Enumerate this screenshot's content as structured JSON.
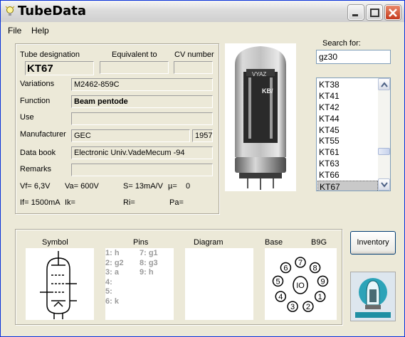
{
  "window": {
    "title": "TubeData"
  },
  "menu": {
    "file": "File",
    "help": "Help"
  },
  "header_labels": {
    "designation": "Tube designation",
    "equivalent": "Equivalent to",
    "cv": "CV number"
  },
  "tube": {
    "designation": "KT67",
    "equivalent": "",
    "cv": "",
    "variations": "M2462-859C",
    "function": "Beam pentode",
    "use": "",
    "manufacturer": "GEC",
    "year": "1957",
    "databook": "Electronic Univ.VadeMecum -94",
    "remarks": ""
  },
  "field_labels": {
    "variations": "Variations",
    "function": "Function",
    "use": "Use",
    "manufacturer": "Manufacturer",
    "databook": "Data book",
    "remarks": "Remarks"
  },
  "params": {
    "vf": "Vf= 6,3V",
    "va": "Va= 600V",
    "s": "S= 13mA/V",
    "mu": "µ=",
    "mu_value": "0",
    "if": "If= 1500mA",
    "ik": "Ik=",
    "ri": "Ri=",
    "pa": "Pa="
  },
  "search": {
    "label": "Search for:",
    "value": "gz30"
  },
  "tube_list": [
    "KT38",
    "KT41",
    "KT42",
    "KT44",
    "KT45",
    "KT55",
    "KT61",
    "KT63",
    "KT66",
    "KT67"
  ],
  "selected_tube": "KT67",
  "bottom_labels": {
    "symbol": "Symbol",
    "pins": "Pins",
    "diagram": "Diagram",
    "base": "Base",
    "base_type": "B9G"
  },
  "pins_left": [
    "1: h",
    "2: g2",
    "3: a",
    "4:",
    "5:",
    "6: k"
  ],
  "pins_right": [
    "7: g1",
    "8: g3",
    "9: h"
  ],
  "base_pin_numbers": [
    "1",
    "2",
    "3",
    "4",
    "5",
    "6",
    "7",
    "8",
    "9"
  ],
  "base_center_label": "IO",
  "buttons": {
    "inventory": "Inventory"
  },
  "colors": {
    "title_bar": "#DCDCDC",
    "selection": "#C9C9C9",
    "pin_text": "#9A9A9A",
    "window_bg": "#ECE9D8"
  },
  "icons": [
    "lightbulb-icon",
    "minimize-icon",
    "maximize-icon",
    "close-icon",
    "scroll-up-icon",
    "scroll-down-icon"
  ]
}
